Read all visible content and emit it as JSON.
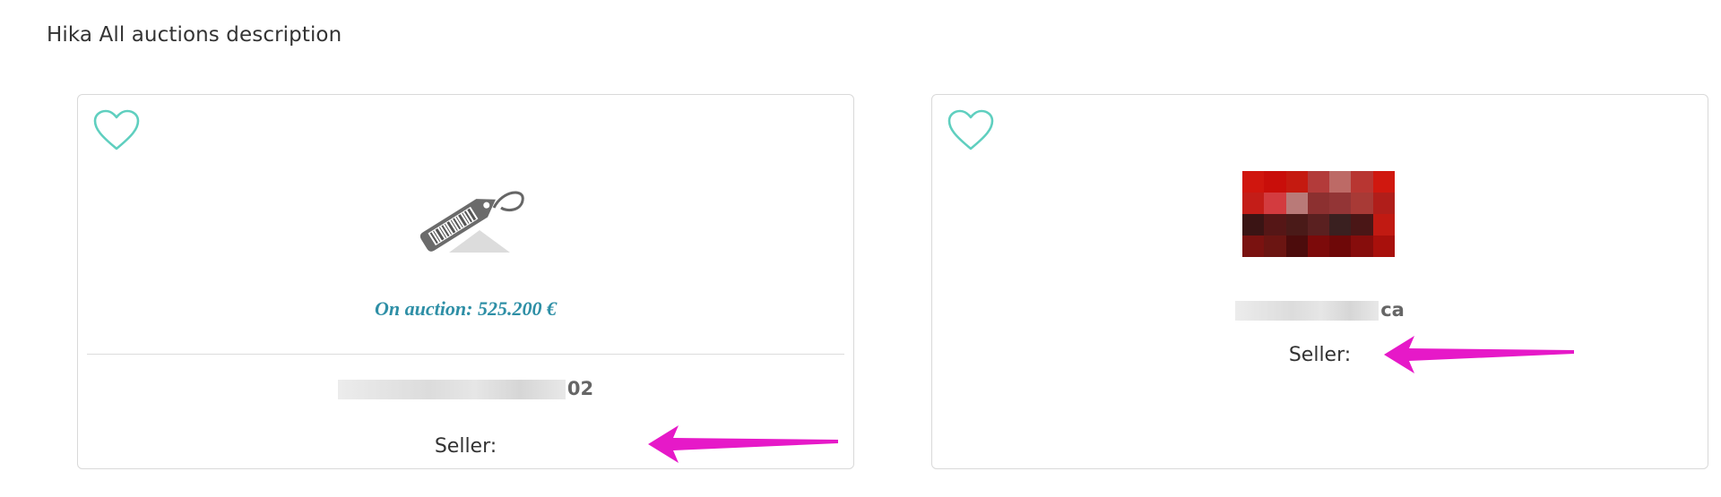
{
  "page": {
    "description": "Hika All auctions description"
  },
  "colors": {
    "heart": "#5fcfbf",
    "price": "#2e8fa6",
    "arrow": "#e619c8",
    "card_border": "#d9d9d9"
  },
  "cards": [
    {
      "favorite_icon": "heart-outline-icon",
      "image": "price-tag-icon",
      "price_text": "On auction: 525.200 €",
      "title_visible_suffix": "02",
      "seller_label": "Seller:",
      "seller_value": ""
    },
    {
      "favorite_icon": "heart-outline-icon",
      "image": "blurred-red-thumbnail",
      "title_visible_suffix": "ca",
      "seller_label": "Seller:",
      "seller_value": ""
    }
  ]
}
